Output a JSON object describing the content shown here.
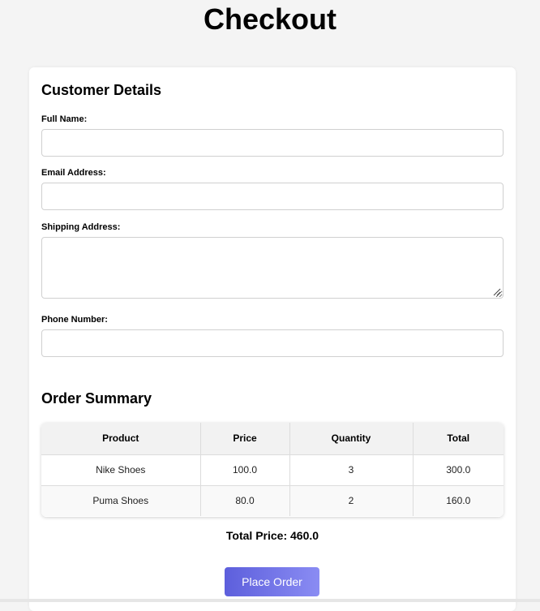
{
  "page": {
    "title": "Checkout"
  },
  "customer": {
    "heading": "Customer Details",
    "full_name_label": "Full Name:",
    "email_label": "Email Address:",
    "address_label": "Shipping Address:",
    "phone_label": "Phone Number:",
    "full_name_value": "",
    "email_value": "",
    "address_value": "",
    "phone_value": ""
  },
  "order": {
    "heading": "Order Summary",
    "columns": [
      "Product",
      "Price",
      "Quantity",
      "Total"
    ],
    "rows": [
      [
        "Nike Shoes",
        "100.0",
        "3",
        "300.0"
      ],
      [
        "Puma Shoes",
        "80.0",
        "2",
        "160.0"
      ]
    ],
    "total_text": "Total Price: 460.0",
    "button_label": "Place Order"
  },
  "colors": {
    "button_gradient_start": "#5d5fdc",
    "button_gradient_end": "#8a8cf3"
  }
}
